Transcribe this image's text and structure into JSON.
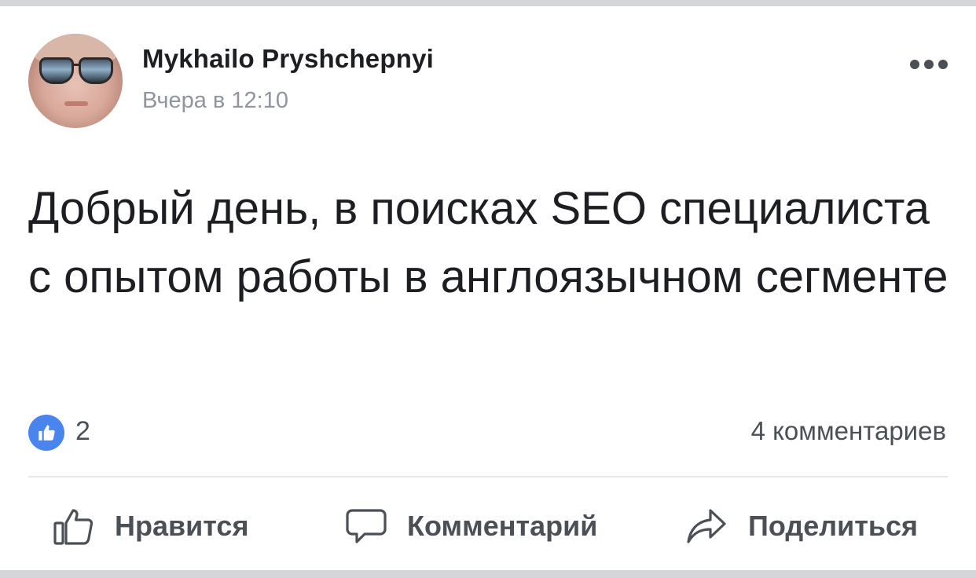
{
  "post": {
    "author_name": "Mykhailo Pryshchepnyi",
    "timestamp": "Вчера в 12:10",
    "text": "Добрый день, в поисках SEO специалиста с опытом работы в англоязычном сегменте",
    "reactions": {
      "icon": "thumbs-up-icon",
      "count": "2"
    },
    "comments_count": "4 комментариев"
  },
  "actions": {
    "like_label": "Нравится",
    "comment_label": "Комментарий",
    "share_label": "Поделиться"
  },
  "colors": {
    "accent": "#4a84ef",
    "text_primary": "#1c1e21",
    "text_secondary": "#90949c",
    "action_text": "#4b4f56"
  }
}
